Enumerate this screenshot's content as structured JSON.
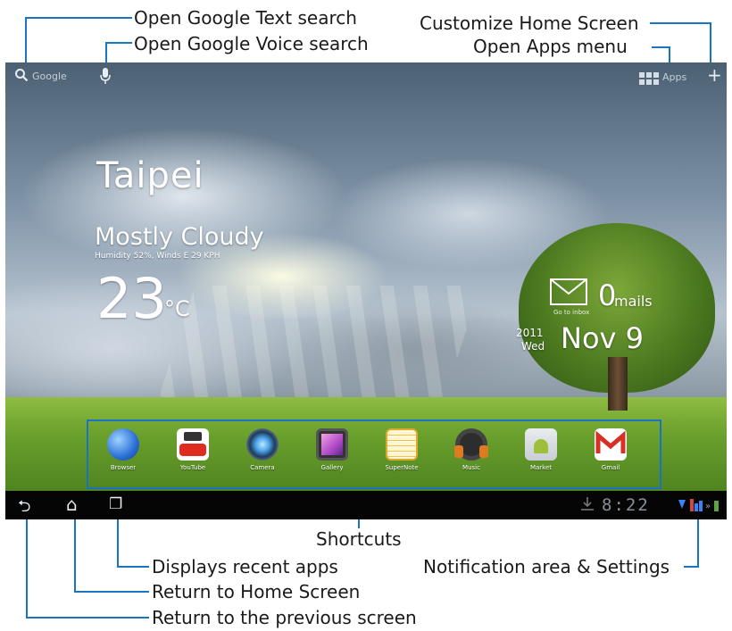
{
  "callouts": {
    "google_text": "Open Google Text search",
    "google_voice": "Open Google Voice search",
    "customize_home": "Customize Home Screen",
    "open_apps": "Open Apps menu",
    "shortcuts": "Shortcuts",
    "recent_apps": "Displays recent apps",
    "home": "Return to Home Screen",
    "back": "Return to the previous screen",
    "notification": "Notification area & Settings"
  },
  "topbar": {
    "search_label": "Google",
    "apps_label": "Apps",
    "add_glyph": "+"
  },
  "weather": {
    "city": "Taipei",
    "condition": "Mostly Cloudy",
    "details": "Humidity 52%, Winds E 29 KPH",
    "temperature": "23",
    "unit": "°C"
  },
  "mail": {
    "count": "0",
    "label": "mails",
    "sub_label": "Go to inbox"
  },
  "date": {
    "year": "2011",
    "weekday": "Wed",
    "month_day": "Nov 9"
  },
  "dock_apps": [
    {
      "label": "Browser",
      "icon": "browser-icon",
      "color": "#2b6fd6"
    },
    {
      "label": "YouTube",
      "icon": "youtube-icon",
      "color": "#e02b20"
    },
    {
      "label": "Camera",
      "icon": "camera-icon",
      "color": "#4aa3e8"
    },
    {
      "label": "Gallery",
      "icon": "gallery-icon",
      "color": "#b04ac8"
    },
    {
      "label": "SuperNote",
      "icon": "supernote-icon",
      "color": "#f2c24a"
    },
    {
      "label": "Music",
      "icon": "music-icon",
      "color": "#e07a20"
    },
    {
      "label": "Market",
      "icon": "market-icon",
      "color": "#9dbf3a"
    },
    {
      "label": "Gmail",
      "icon": "gmail-icon",
      "color": "#d93025"
    }
  ],
  "navbar": {
    "clock": "8:22",
    "back_glyph": "⮌",
    "home_glyph": "⌂",
    "recent_glyph": "❐"
  },
  "accent_color": "#1a74c6"
}
